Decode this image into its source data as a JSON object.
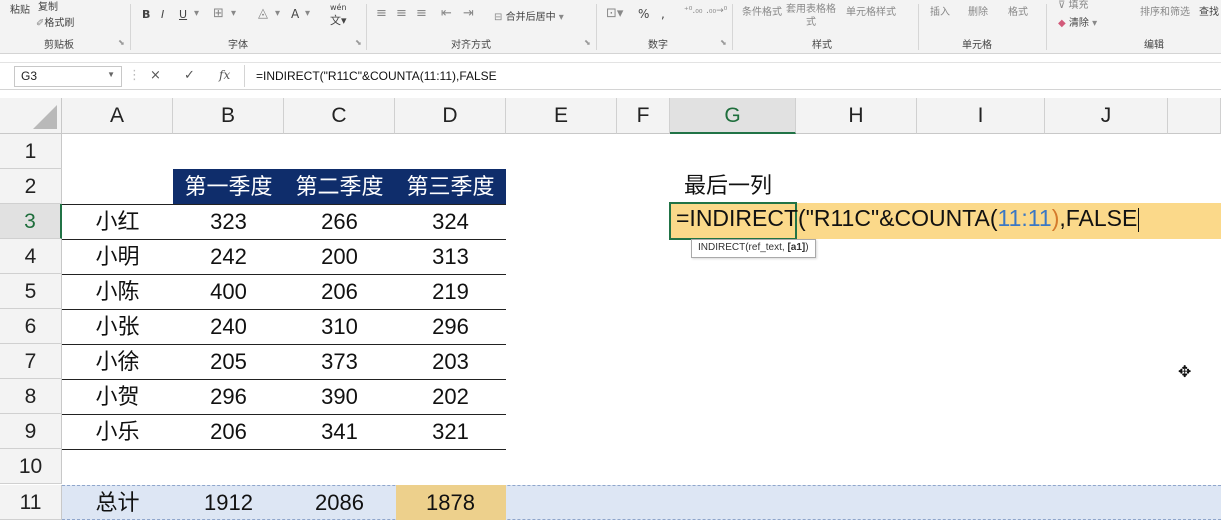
{
  "ribbon": {
    "clipboard": {
      "paste": "粘贴",
      "copy": "复制",
      "format_painter": "格式刷",
      "group": "剪贴板"
    },
    "font": {
      "bold": "B",
      "italic": "I",
      "underline": "U",
      "font_color": "A",
      "group": "字体",
      "wen": "wén"
    },
    "alignment": {
      "merge_center": "合并后居中",
      "group": "对齐方式"
    },
    "number": {
      "percent": "%",
      "comma": ",",
      "group": "数字"
    },
    "styles": {
      "conditional": "条件格式",
      "table_format": "套用表格格式",
      "cell_styles": "单元格样式",
      "group": "样式"
    },
    "cells": {
      "insert": "插入",
      "delete": "删除",
      "format": "格式",
      "group": "单元格"
    },
    "editing": {
      "fill": "填充",
      "clear": "清除",
      "sort_filter": "排序和筛选",
      "find": "查找",
      "group": "编辑"
    }
  },
  "formula_bar": {
    "name_box": "G3",
    "cancel_icon": "×",
    "enter_icon": "✓",
    "fx_label": "fx",
    "formula": "=INDIRECT(\"R11C\"&COUNTA(11:11),FALSE"
  },
  "columns": [
    "A",
    "B",
    "C",
    "D",
    "E",
    "F",
    "G",
    "H",
    "I",
    "J"
  ],
  "rows": [
    "1",
    "2",
    "3",
    "4",
    "5",
    "6",
    "7",
    "8",
    "9",
    "10",
    "11"
  ],
  "table": {
    "headers": [
      "第一季度",
      "第二季度",
      "第三季度"
    ],
    "rows": [
      {
        "name": "小红",
        "values": [
          "323",
          "266",
          "324"
        ]
      },
      {
        "name": "小明",
        "values": [
          "242",
          "200",
          "313"
        ]
      },
      {
        "name": "小陈",
        "values": [
          "400",
          "206",
          "219"
        ]
      },
      {
        "name": "小张",
        "values": [
          "240",
          "310",
          "296"
        ]
      },
      {
        "name": "小徐",
        "values": [
          "205",
          "373",
          "203"
        ]
      },
      {
        "name": "小贺",
        "values": [
          "296",
          "390",
          "202"
        ]
      },
      {
        "name": "小乐",
        "values": [
          "206",
          "341",
          "321"
        ]
      }
    ],
    "total": {
      "name": "总计",
      "values": [
        "1912",
        "2086",
        "1878"
      ]
    }
  },
  "g2_label": "最后一列",
  "edit": {
    "prefix": "=INDIRECT(\"R11C\"&COUNTA(",
    "ref": "11:11",
    "close": ")",
    "suffix": ",FALSE"
  },
  "tooltip": {
    "text": "INDIRECT(ref_text, ",
    "bold": "[a1]",
    "end": ")"
  },
  "colors": {
    "header_fill": "#0f2d6b",
    "active_green": "#217346",
    "edit_fill": "#fbd98a",
    "row11_band": "#dde6f4",
    "total_highlight": "#edd08c"
  },
  "active_cell": "G3"
}
